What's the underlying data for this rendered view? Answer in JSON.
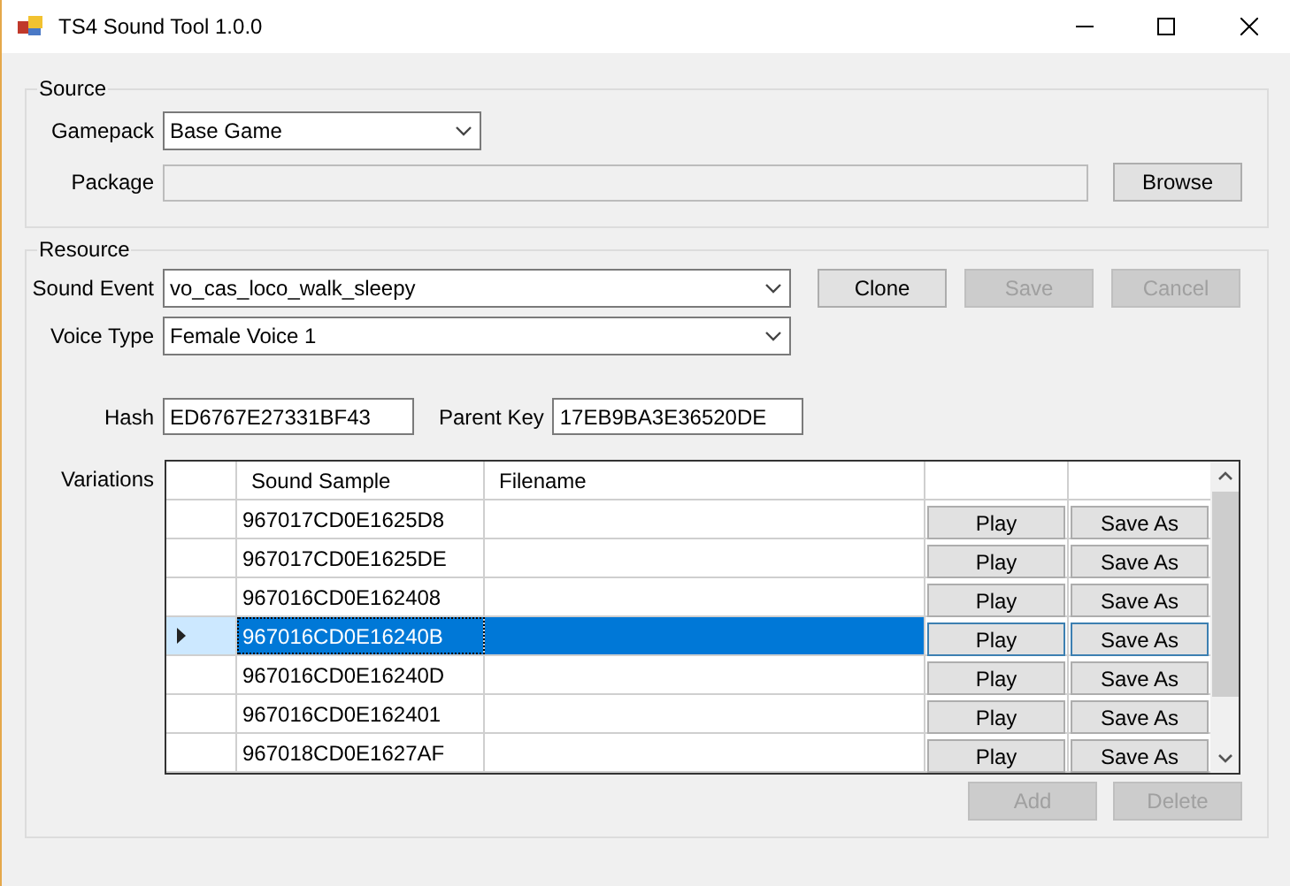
{
  "window": {
    "title": "TS4 Sound Tool 1.0.0"
  },
  "source": {
    "legend": "Source",
    "gamepack": {
      "label": "Gamepack",
      "value": "Base Game"
    },
    "package": {
      "label": "Package",
      "disabled": true
    },
    "browse": {
      "label": "Browse",
      "disabled": false
    }
  },
  "resource": {
    "legend": "Resource",
    "sound_event": {
      "label": "Sound Event",
      "value": "vo_cas_loco_walk_sleepy"
    },
    "voice_type": {
      "label": "Voice Type",
      "value": "Female Voice 1"
    },
    "buttons": [
      {
        "label": "Clone",
        "disabled": false
      },
      {
        "label": "Save",
        "disabled": true
      },
      {
        "label": "Cancel",
        "disabled": true
      }
    ],
    "hash": {
      "label": "Hash",
      "value": "ED6767E27331BF43"
    },
    "parent_key": {
      "label": "Parent Key",
      "value": "17EB9BA3E36520DE"
    },
    "variations": {
      "label": "Variations",
      "columns": [
        "Sound Sample",
        "Filename"
      ],
      "rows": [
        {
          "sound_sample": "967017CD0E1625D8",
          "play": "Play",
          "save_as": "Save As",
          "selected": false
        },
        {
          "sound_sample": "967017CD0E1625DE",
          "play": "Play",
          "save_as": "Save As",
          "selected": false
        },
        {
          "sound_sample": "967016CD0E162408",
          "play": "Play",
          "save_as": "Save As",
          "selected": false
        },
        {
          "sound_sample": "967016CD0E16240B",
          "play": "Play",
          "save_as": "Save As",
          "selected": true
        },
        {
          "sound_sample": "967016CD0E16240D",
          "play": "Play",
          "save_as": "Save As",
          "selected": false
        },
        {
          "sound_sample": "967016CD0E162401",
          "play": "Play",
          "save_as": "Save As",
          "selected": false
        },
        {
          "sound_sample": "967018CD0E1627AF",
          "play": "Play",
          "save_as": "Save As",
          "selected": false
        }
      ]
    },
    "bottom_buttons": [
      {
        "label": "Add",
        "disabled": true
      },
      {
        "label": "Delete",
        "disabled": true
      }
    ]
  }
}
